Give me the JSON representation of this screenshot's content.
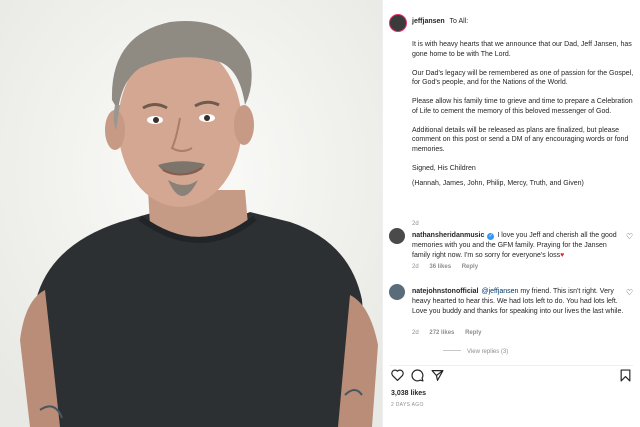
{
  "post": {
    "username": "jeffjansen",
    "header_text": "To All:",
    "paragraphs": [
      "It is with heavy hearts that we announce that our Dad, Jeff Jansen, has gone home to be with The Lord.",
      "Our Dad's legacy will be remembered as one of passion for the Gospel, for God's people, and for the Nations of the World.",
      "Please allow his family time to grieve and time to prepare a Celebration of Life to cement the memory of this beloved messenger of God.",
      "Additional details will be released as plans are finalized, but please comment on this post or send a DM of any encouraging words or fond memories.",
      "Signed, His Children",
      "(Hannah, James, John, Philip, Mercy, Truth, and Given)"
    ],
    "time": "2d"
  },
  "comments": [
    {
      "username": "nathansheridanmusic",
      "text": "I love you Jeff and cherish all the good memories with you and the GFM family. Praying for the Jansen family right now. I'm so sorry for everyone's loss",
      "time": "2d",
      "likes": "36 likes",
      "reply": "Reply"
    },
    {
      "username": "natejohnstonofficial",
      "mention": "@jeffjansen",
      "text": "my friend. This isn't right. Very heavy hearted to hear this. We had lots left to do. You had lots left. Love you buddy and thanks for speaking into our lives the last while.",
      "time": "2d",
      "likes": "272 likes",
      "reply": "Reply",
      "view_replies": "View replies (3)"
    }
  ],
  "footer": {
    "likes": "3,038 likes",
    "date": "2 DAYS AGO"
  },
  "colors": {
    "verified": "#3897f0",
    "heart_red": "#d92c2c",
    "muted": "#8e8e8e"
  }
}
